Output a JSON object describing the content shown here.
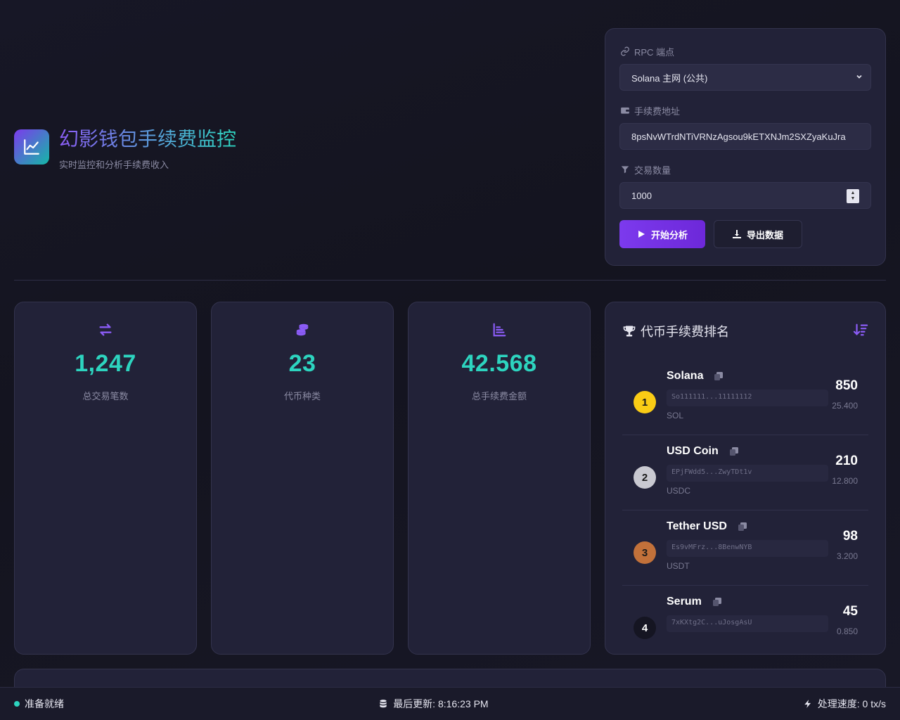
{
  "header": {
    "title": "幻影钱包手续费监控",
    "subtitle": "实时监控和分析手续费收入"
  },
  "config": {
    "rpc_label": "RPC 端点",
    "rpc_value": "Solana 主网 (公共)",
    "fee_address_label": "手续费地址",
    "fee_address_value": "8psNvWTrdNTiVRNzAgsou9kETXNJm2SXZyaKuJra",
    "tx_count_label": "交易数量",
    "tx_count_value": "1000",
    "start_button": "开始分析",
    "export_button": "导出数据"
  },
  "stats": [
    {
      "icon": "exchange-icon",
      "value": "1,247",
      "label": "总交易笔数"
    },
    {
      "icon": "coins-icon",
      "value": "23",
      "label": "代币种类"
    },
    {
      "icon": "chart-icon",
      "value": "42.568",
      "label": "总手续费金额"
    }
  ],
  "ranking": {
    "title": "代币手续费排名",
    "items": [
      {
        "rank": "1",
        "name": "Solana",
        "address": "So111111...11111112",
        "symbol": "SOL",
        "amount": "850",
        "fee": "25.400",
        "badge_color": "#facc15",
        "badge_text": "#1a1a1a"
      },
      {
        "rank": "2",
        "name": "USD Coin",
        "address": "EPjFWdd5...ZwyTDt1v",
        "symbol": "USDC",
        "amount": "210",
        "fee": "12.800",
        "badge_color": "#c9c9d1",
        "badge_text": "#1a1a1a"
      },
      {
        "rank": "3",
        "name": "Tether USD",
        "address": "Es9vMFrz...8BenwNYB",
        "symbol": "USDT",
        "amount": "98",
        "fee": "3.200",
        "badge_color": "#c2713a",
        "badge_text": "#1a1a1a"
      },
      {
        "rank": "4",
        "name": "Serum",
        "address": "7xKXtg2C...uJosgAsU",
        "symbol": "",
        "amount": "45",
        "fee": "0.850",
        "badge_color": "#151522",
        "badge_text": "#ffffff"
      }
    ]
  },
  "status": {
    "ready": "准备就绪",
    "last_update": "最后更新: 8:16:23 PM",
    "speed": "处理速度: 0 tx/s"
  },
  "colors": {
    "accent": "#7c3aed",
    "value": "#2dd4bf",
    "background": "#14141f",
    "card": "#222238"
  }
}
